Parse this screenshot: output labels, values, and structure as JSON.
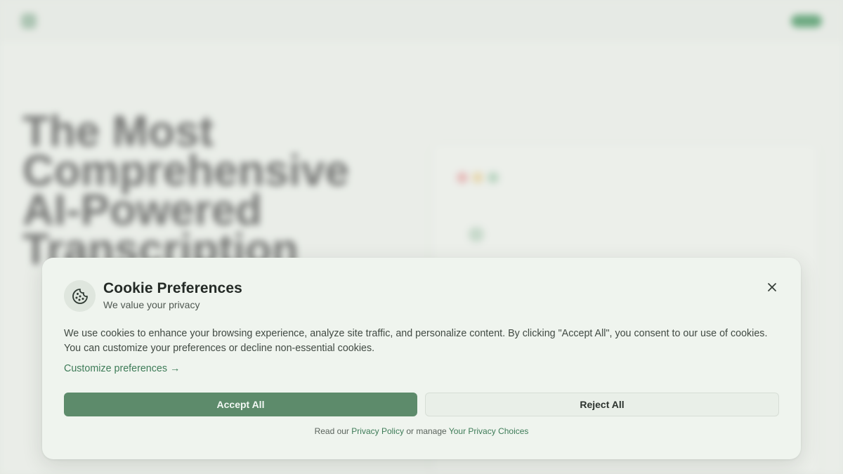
{
  "background": {
    "brand": "",
    "nav_links": [
      "",
      "",
      "",
      "",
      "",
      ""
    ],
    "login": "",
    "cta": "",
    "badge": "",
    "hero_title": "The Most Comprehensive AI-Powered Transcription",
    "preview_title": "",
    "preview_row_title": "",
    "preview_row_text": "",
    "preview_bottom": ""
  },
  "cookie_dialog": {
    "icon": "cookie-icon",
    "title": "Cookie Preferences",
    "subtitle": "We value your privacy",
    "close_icon": "close-icon",
    "body": "We use cookies to enhance your browsing experience, analyze site traffic, and personalize content. By clicking \"Accept All\", you consent to our use of cookies. You can customize your preferences or decline non-essential cookies.",
    "customize_link": "Customize preferences →",
    "accept_label": "Accept All",
    "reject_label": "Reject All",
    "footer": {
      "prefix": "Read our",
      "privacy_policy": "Privacy Policy",
      "middle": "or manage",
      "privacy_choices": "Your Privacy Choices"
    }
  },
  "colors": {
    "accent_green": "#5d8b6b",
    "link_green": "#3d7b57",
    "dialog_bg": "#eff4ee"
  }
}
